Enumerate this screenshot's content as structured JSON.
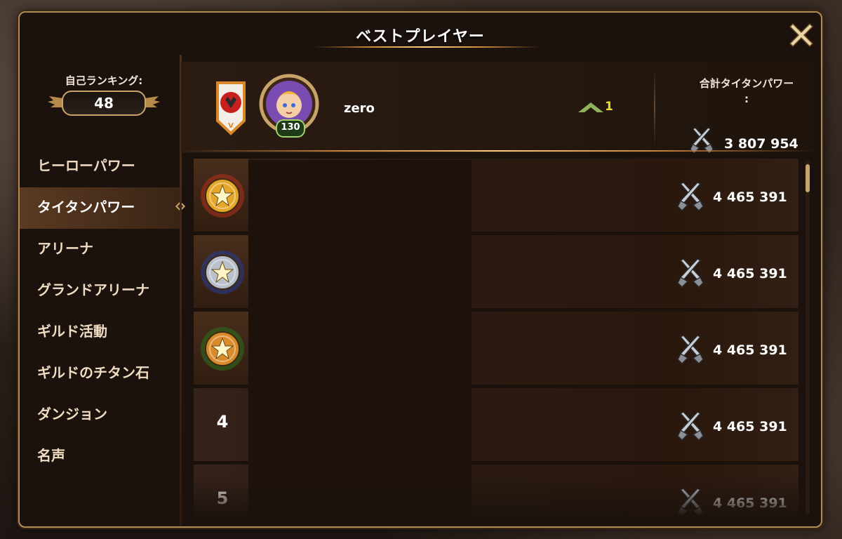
{
  "window": {
    "title": "ベストプレイヤー"
  },
  "self_rank": {
    "label": "自己ランキング:",
    "value": "48"
  },
  "categories": [
    {
      "label": "ヒーローパワー",
      "active": false
    },
    {
      "label": "タイタンパワー",
      "active": true
    },
    {
      "label": "アリーナ",
      "active": false
    },
    {
      "label": "グランドアリーナ",
      "active": false
    },
    {
      "label": "ギルド活動",
      "active": false
    },
    {
      "label": "ギルドのチタン石",
      "active": false
    },
    {
      "label": "ダンジョン",
      "active": false
    },
    {
      "label": "名声",
      "active": false
    }
  ],
  "my_entry": {
    "level": "130",
    "name": "zero",
    "rank_change": "1",
    "total_label": "合計タイタンパワー\n:",
    "total_value": "3 807 954"
  },
  "rows": [
    {
      "rank": "",
      "medal": "gold",
      "power": "4 465 391"
    },
    {
      "rank": "",
      "medal": "silver",
      "power": "4 465 391"
    },
    {
      "rank": "",
      "medal": "bronze",
      "power": "4 465 391"
    },
    {
      "rank": "4",
      "medal": "",
      "power": "4 465 391"
    },
    {
      "rank": "5",
      "medal": "",
      "power": "4 465 391"
    }
  ],
  "icons": {
    "close": "close-icon",
    "sword": "crossed-swords-icon",
    "banner": "guild-banner-icon",
    "avatar": "hero-avatar-icon",
    "rank_up": "rank-up-arrow-icon"
  },
  "colors": {
    "gold": "#e5a72a",
    "silver": "#b9c0cc",
    "bronze": "#d98a2b",
    "accent": "#c9a46a"
  }
}
